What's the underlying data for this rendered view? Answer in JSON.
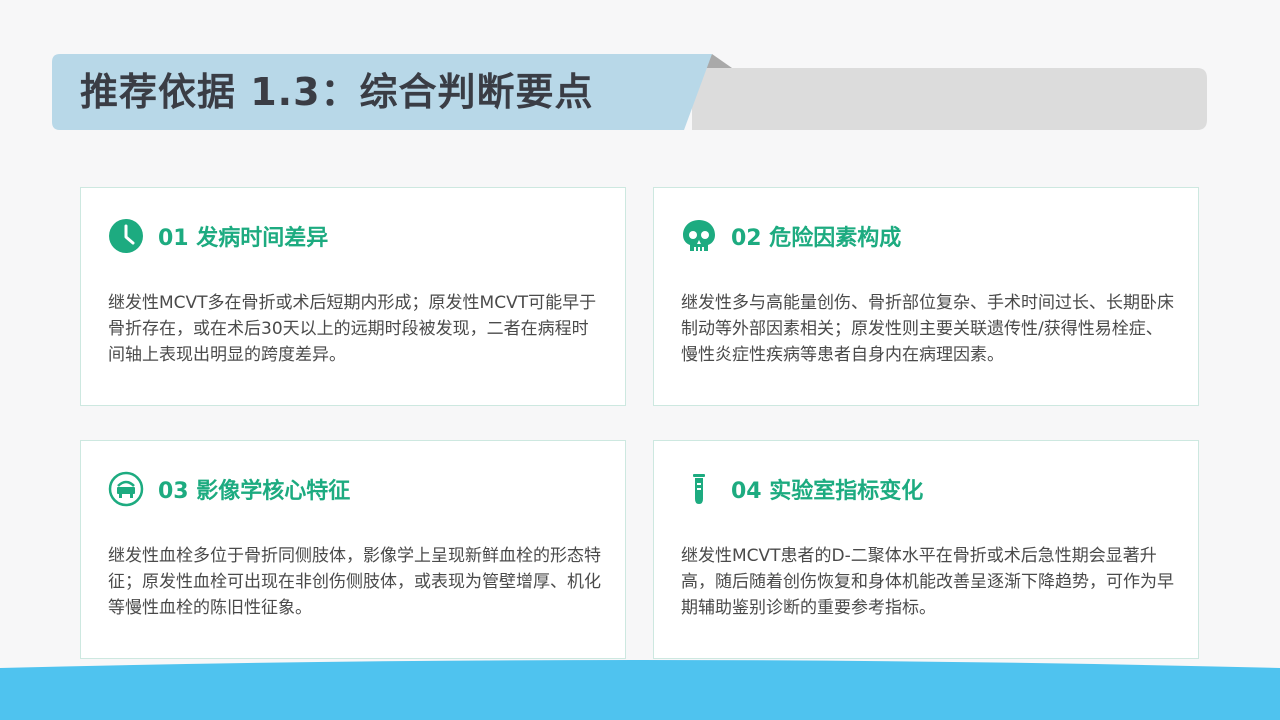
{
  "title": "推荐依据 1.3：综合判断要点",
  "colors": {
    "accent": "#1dab80",
    "title_bg": "#b8d8e8",
    "title_tab": "#dcdcdc",
    "wave": "#4fc3ef"
  },
  "cards": [
    {
      "icon": "clock-icon",
      "title": "01 发病时间差异",
      "body": "继发性MCVT多在骨折或术后短期内形成；原发性MCVT可能早于骨折存在，或在术后30天以上的远期时段被发现，二者在病程时间轴上表现出明显的跨度差异。"
    },
    {
      "icon": "skull-icon",
      "title": "02 危险因素构成",
      "body": "继发性多与高能量创伤、骨折部位复杂、手术时间过长、长期卧床制动等外部因素相关；原发性则主要关联遗传性/获得性易栓症、慢性炎症性疾病等患者自身内在病理因素。"
    },
    {
      "icon": "scan-icon",
      "title": "03 影像学核心特征",
      "body": "继发性血栓多位于骨折同侧肢体，影像学上呈现新鲜血栓的形态特征；原发性血栓可出现在非创伤侧肢体，或表现为管壁增厚、机化等慢性血栓的陈旧性征象。"
    },
    {
      "icon": "test-tube-icon",
      "title": "04 实验室指标变化",
      "body": "继发性MCVT患者的D-二聚体水平在骨折或术后急性期会显著升高，随后随着创伤恢复和身体机能改善呈逐渐下降趋势，可作为早期辅助鉴别诊断的重要参考指标。"
    }
  ]
}
